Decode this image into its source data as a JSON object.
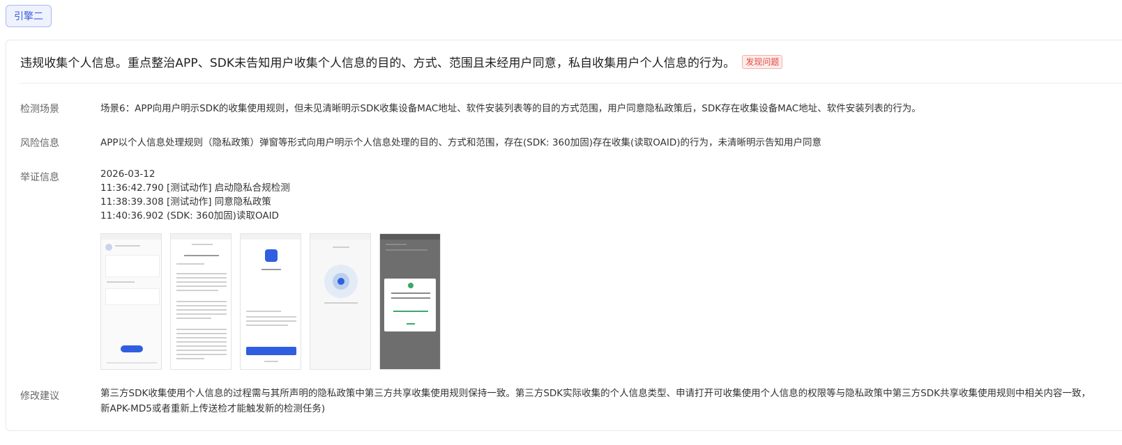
{
  "engine": {
    "label": "引擎二"
  },
  "card": {
    "title": "违规收集个人信息。重点整治APP、SDK未告知用户收集个人信息的目的、方式、范围且未经用户同意，私自收集用户个人信息的行为。",
    "badge": "发现问题"
  },
  "scene": {
    "label": "检测场景",
    "value": "场景6：APP向用户明示SDK的收集使用规则，但未见清晰明示SDK收集设备MAC地址、软件安装列表等的目的方式范围，用户同意隐私政策后，SDK存在收集设备MAC地址、软件安装列表的行为。"
  },
  "risk": {
    "label": "风险信息",
    "value": "APP以个人信息处理规则（隐私政策）弹窗等形式向用户明示个人信息处理的目的、方式和范围，存在(SDK: 360加固)存在收集(读取OAID)的行为，未清晰明示告知用户同意"
  },
  "evidence": {
    "label": "举证信息",
    "lines": [
      "2026-03-12",
      "11:36:42.790 [测试动作] 启动隐私合规检测",
      "11:38:39.308 [测试动作] 同意隐私政策",
      "11:40:36.902 (SDK: 360加固)读取OAID"
    ]
  },
  "suggestion": {
    "label": "修改建议",
    "line1": "第三方SDK收集使用个人信息的过程需与其所声明的隐私政策中第三方共享收集使用规则保持一致。第三方SDK实际收集的个人信息类型、申请打开可收集使用个人信息的权限等与隐私政策中第三方SDK共享收集使用规则中相关内容一致，",
    "line2": "新APK-MD5或者重新上传送检才能触发新的检测任务)"
  }
}
